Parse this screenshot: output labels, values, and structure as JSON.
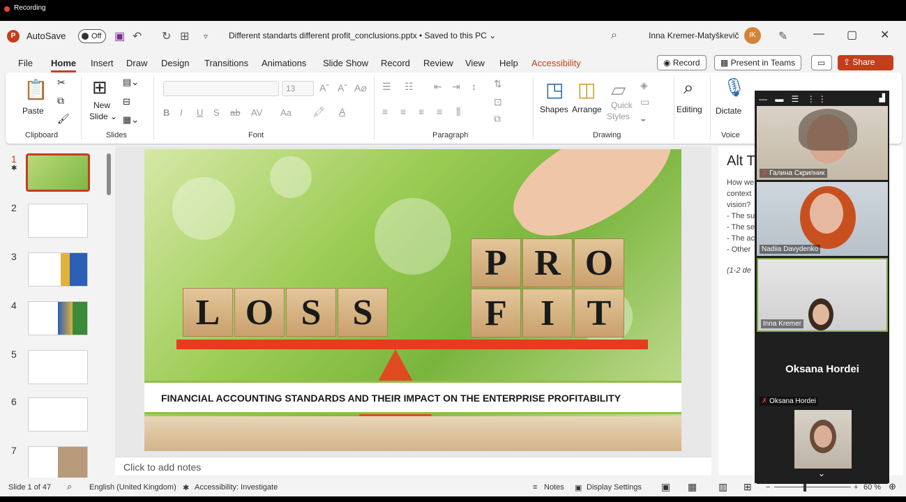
{
  "recording": {
    "label": "Recording"
  },
  "titlebar": {
    "app_icon": "P",
    "autosave_label": "AutoSave",
    "autosave_state": "Off",
    "document_title": "Different standarts different profit_conclusions.pptx • Saved to this PC ⌄",
    "user_name": "Inna Kremer-Matyškevič",
    "user_initials": "IK",
    "icons": [
      "save-icon",
      "undo-icon",
      "redo-icon",
      "present-icon",
      "search-icon",
      "pen-icon",
      "minimize-icon",
      "restore-icon",
      "close-icon"
    ]
  },
  "menu": {
    "items": [
      "File",
      "Home",
      "Insert",
      "Draw",
      "Design",
      "Transitions",
      "Animations",
      "Slide Show",
      "Record",
      "Review",
      "View",
      "Help",
      "Accessibility"
    ],
    "active": "Home",
    "record_button": "Record",
    "present_button": "Present in Teams",
    "share_button": "Share"
  },
  "ribbon": {
    "groups": [
      "Clipboard",
      "Slides",
      "Font",
      "Paragraph",
      "Drawing",
      "Voice"
    ],
    "paste": "Paste",
    "new_slide_1": "New",
    "new_slide_2": "Slide ⌄",
    "font_size": "13",
    "font_buttons": [
      "B",
      "I",
      "U",
      "S",
      "ab",
      "AV",
      "Aa"
    ],
    "shapes": "Shapes",
    "arrange": "Arrange",
    "quick_styles_1": "Quick",
    "quick_styles_2": "Styles",
    "editing": "Editing",
    "dictate": "Dictate"
  },
  "thumbnails": {
    "numbers": [
      "1",
      "2",
      "3",
      "4",
      "5",
      "6",
      "7"
    ],
    "selected": "1"
  },
  "slide": {
    "loss_letters": [
      "L",
      "O",
      "S",
      "S"
    ],
    "pro_letters": [
      "P",
      "R",
      "O"
    ],
    "fit_letters": [
      "F",
      "I",
      "T"
    ],
    "banner": "FINANCIAL ACCOUNTING STANDARDS AND THEIR IMPACT ON THE ENTERPRISE PROFITABILITY"
  },
  "notes": {
    "placeholder": "Click to add notes"
  },
  "alt_text": {
    "title": "Alt T",
    "lines": [
      "How we",
      "context",
      "vision?",
      "- The su",
      "- The se",
      "- The ac",
      "- Other"
    ],
    "hint": "(1-2 de"
  },
  "teams": {
    "participants": [
      {
        "name": "Галина Скрипник",
        "muted": true
      },
      {
        "name": "Nadiia Davydenko",
        "muted": false
      },
      {
        "name": "Inna Kremer",
        "muted": false
      },
      {
        "name": "Oksana Hordei",
        "muted": true
      }
    ],
    "center_name": "Oksana Hordei"
  },
  "statusbar": {
    "slide_count": "Slide 1 of 47",
    "language": "English (United Kingdom)",
    "accessibility": "Accessibility: Investigate",
    "notes": "Notes",
    "display_settings": "Display Settings",
    "zoom": "60 %",
    "zoom_level": 0.6
  },
  "colors": {
    "accent": "#c43e1c",
    "beam": "#e63b1f",
    "banner_rule": "#8fbf4a"
  }
}
